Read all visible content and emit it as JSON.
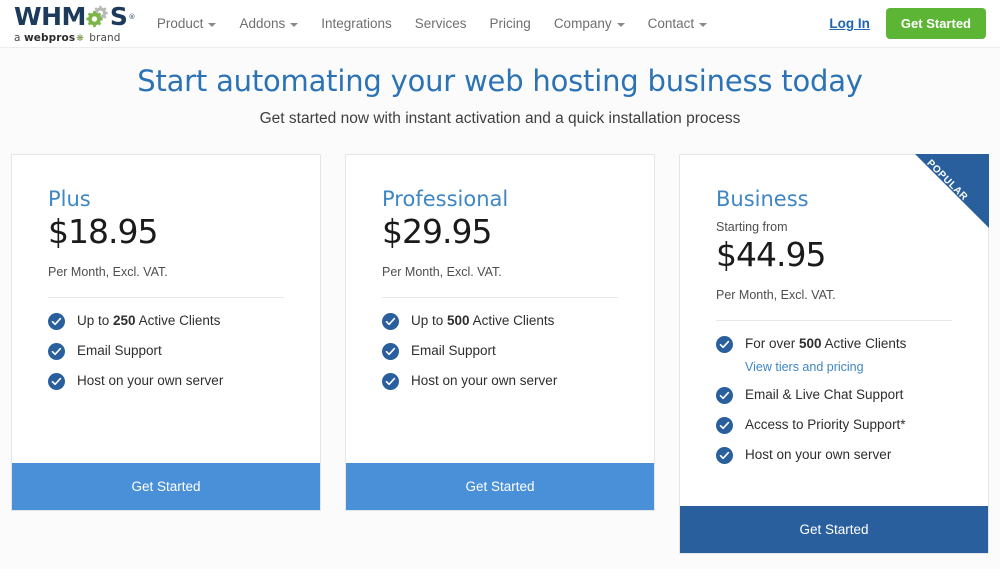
{
  "brand": {
    "logo_text_1": "WHM",
    "logo_text_2": "S",
    "logo_registered": "®",
    "tagline_prefix": "a ",
    "tagline_bold": "webpros",
    "tagline_suffix": " brand",
    "gear_green": "#7ab648",
    "gear_gray": "#b9b9b9",
    "logo_color": "#1b3a5c"
  },
  "nav": {
    "items": [
      {
        "label": "Product",
        "has_caret": true
      },
      {
        "label": "Addons",
        "has_caret": true
      },
      {
        "label": "Integrations",
        "has_caret": false
      },
      {
        "label": "Services",
        "has_caret": false
      },
      {
        "label": "Pricing",
        "has_caret": false
      },
      {
        "label": "Company",
        "has_caret": true
      },
      {
        "label": "Contact",
        "has_caret": true
      }
    ],
    "login_label": "Log In",
    "get_started_label": "Get Started",
    "get_started_color": "#5cb534",
    "login_color": "#1f64b0"
  },
  "hero": {
    "heading": "Start automating your web hosting business today",
    "subheading": "Get started now with instant activation and a quick installation process",
    "heading_color": "#2c73b5"
  },
  "plans": [
    {
      "name": "Plus",
      "starting_from": null,
      "price": "$18.95",
      "price_note": "Per Month, Excl. VAT.",
      "features": [
        {
          "pre": "Up to ",
          "bold": "250",
          "post": " Active Clients",
          "sub_link": null
        },
        {
          "pre": "Email Support",
          "bold": "",
          "post": "",
          "sub_link": null
        },
        {
          "pre": "Host on your own server",
          "bold": "",
          "post": "",
          "sub_link": null
        }
      ],
      "cta_label": "Get Started",
      "cta_color": "#4a90d9",
      "popular": false,
      "ribbon_label": ""
    },
    {
      "name": "Professional",
      "starting_from": null,
      "price": "$29.95",
      "price_note": "Per Month, Excl. VAT.",
      "features": [
        {
          "pre": "Up to ",
          "bold": "500",
          "post": " Active Clients",
          "sub_link": null
        },
        {
          "pre": "Email Support",
          "bold": "",
          "post": "",
          "sub_link": null
        },
        {
          "pre": "Host on your own server",
          "bold": "",
          "post": "",
          "sub_link": null
        }
      ],
      "cta_label": "Get Started",
      "cta_color": "#4a90d9",
      "popular": false,
      "ribbon_label": ""
    },
    {
      "name": "Business",
      "starting_from": "Starting from",
      "price": "$44.95",
      "price_note": "Per Month, Excl. VAT.",
      "features": [
        {
          "pre": "For over ",
          "bold": "500",
          "post": " Active Clients",
          "sub_link": "View tiers and pricing"
        },
        {
          "pre": "Email & Live Chat Support",
          "bold": "",
          "post": "",
          "sub_link": null
        },
        {
          "pre": "Access to Priority Support*",
          "bold": "",
          "post": "",
          "sub_link": null
        },
        {
          "pre": "Host on your own server",
          "bold": "",
          "post": "",
          "sub_link": null
        }
      ],
      "cta_label": "Get Started",
      "cta_color": "#2a5f9e",
      "popular": true,
      "ribbon_label": "POPULAR"
    }
  ],
  "theme": {
    "check_circle": "#2a5f9e",
    "card_border": "#e6e6e6",
    "page_bg": "#fbfbfb"
  }
}
